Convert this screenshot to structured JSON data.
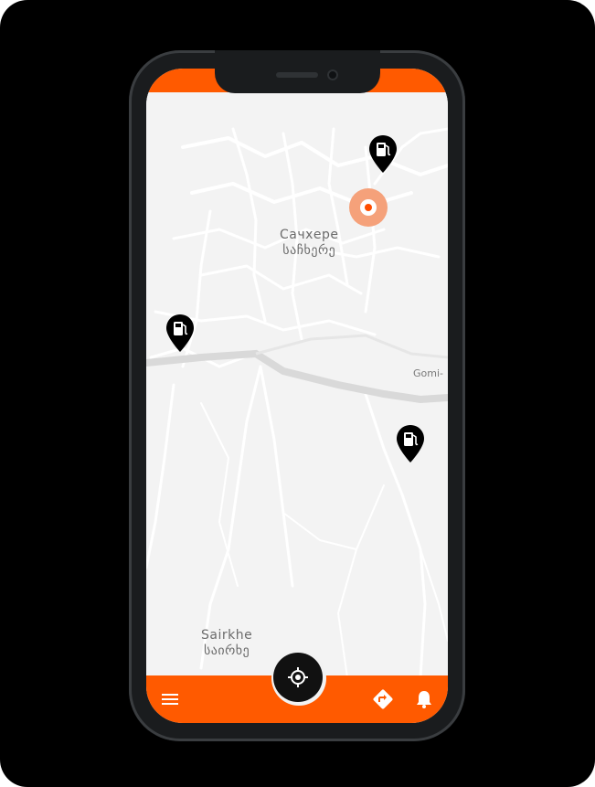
{
  "map": {
    "places": [
      {
        "name_ru": "Сачхере",
        "name_ka": "საჩხერე"
      },
      {
        "name_en": "Sairkhe",
        "name_ka": "საირხე"
      }
    ],
    "road_label": "Gomi-",
    "fuel_pins": [
      {
        "icon": "fuel-pump-icon"
      },
      {
        "icon": "fuel-pump-icon"
      },
      {
        "icon": "fuel-pump-icon"
      }
    ],
    "current_location_icon": "current-location-marker"
  },
  "bottom_bar": {
    "menu_icon": "hamburger-menu-icon",
    "locate_icon": "crosshair-locate-icon",
    "directions_icon": "directions-icon",
    "notifications_icon": "bell-icon"
  },
  "colors": {
    "accent": "#ff5a00",
    "map_background": "#f3f3f3",
    "pin": "#000000",
    "location_halo": "#f5a17a"
  }
}
